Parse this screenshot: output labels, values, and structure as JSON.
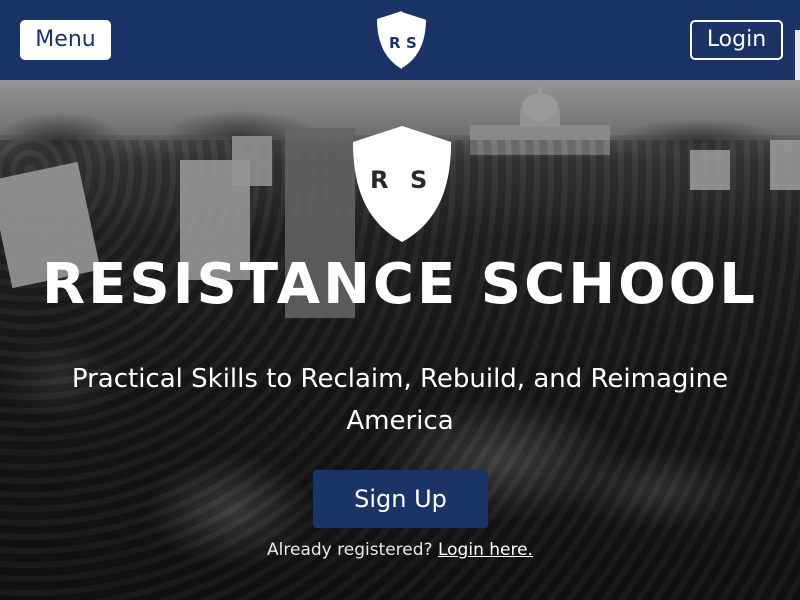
{
  "header": {
    "menu_label": "Menu",
    "login_label": "Login",
    "logo_letters": "R S"
  },
  "hero": {
    "logo_letters": "R S",
    "title": "RESISTANCE SCHOOL",
    "subtitle": "Practical Skills to Reclaim, Rebuild, and Reimagine America",
    "signup_label": "Sign Up",
    "registered_prompt": "Already registered?",
    "login_link_label": "Login here."
  },
  "colors": {
    "brand_navy": "#1b3468",
    "white": "#ffffff"
  },
  "icons": {
    "logo": "shield-logo-icon"
  }
}
